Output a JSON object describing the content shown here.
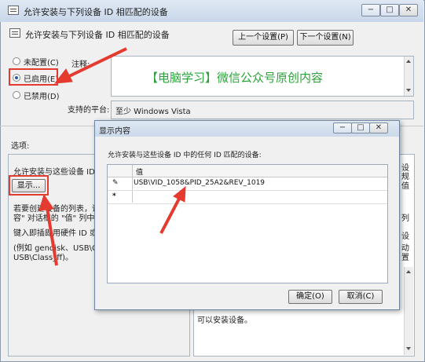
{
  "window": {
    "title": "允许安装与下列设备 ID 相匹配的设备",
    "controls": [
      "−",
      "□",
      "✕"
    ]
  },
  "header": {
    "policy_name": "允许安装与下列设备 ID 相匹配的设备",
    "prev_button": "上一个设置(P)",
    "next_button": "下一个设置(N)"
  },
  "state": {
    "options": [
      {
        "label": "未配置(C)",
        "selected": false
      },
      {
        "label": "已启用(E)",
        "selected": true
      },
      {
        "label": "已禁用(D)",
        "selected": false
      }
    ]
  },
  "comment": {
    "label": "注释:",
    "watermark": "【电脑学习】微信公众号原创内容",
    "watermark_color": "#2aa33a"
  },
  "supported": {
    "label": "支持的平台:",
    "value": "至少 Windows Vista"
  },
  "options_panel": {
    "label": "选项:",
    "item_label": "允许安装与这些设备 ID 中",
    "show_button": "显示...",
    "help_lines": [
      "若要创建设备的列表，请单",
      "容\" 对话框的 \"值\" 列中",
      "键入即插即用硬件 ID 或兼",
      "(例如 gendisk、USB\\COM",
      "USB\\Class_ff)。"
    ]
  },
  "right_fragments": [
    "设",
    "规",
    "值",
    "列",
    "设",
    "动",
    "置"
  ],
  "right_bottom_text": "可以安装设备。",
  "dialog": {
    "title": "显示内容",
    "controls": [
      "−",
      "□",
      "✕"
    ],
    "prompt": "允许安装与这些设备 ID 中的任何 ID 匹配的设备:",
    "column_header": "值",
    "rows": [
      {
        "marker": "✎",
        "value": "USB\\VID_1058&PID_25A2&REV_1019"
      },
      {
        "marker": "*",
        "value": ""
      }
    ],
    "ok_button": "确定(O)",
    "cancel_button": "取消(C)"
  },
  "annotation_color": "#e53a2f"
}
